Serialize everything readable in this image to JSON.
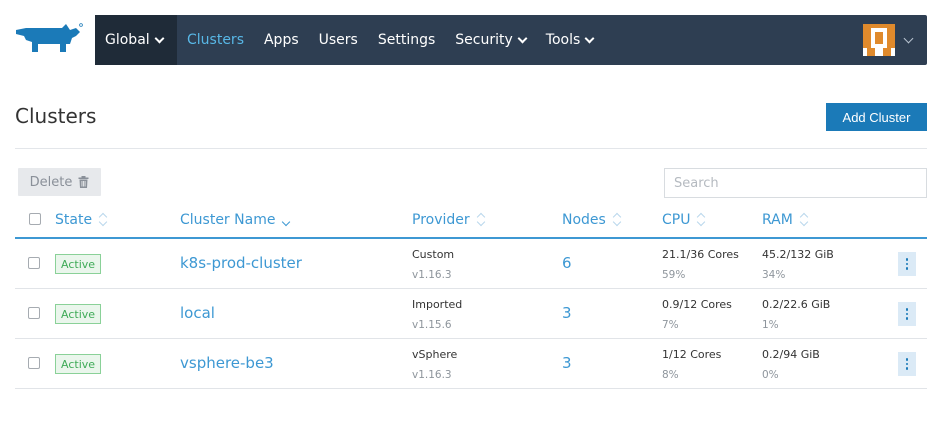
{
  "nav": {
    "global_label": "Global",
    "items": [
      {
        "label": "Clusters",
        "active": true
      },
      {
        "label": "Apps"
      },
      {
        "label": "Users"
      },
      {
        "label": "Settings"
      },
      {
        "label": "Security",
        "dropdown": true
      },
      {
        "label": "Tools",
        "dropdown": true
      }
    ]
  },
  "page": {
    "title": "Clusters",
    "add_button": "Add Cluster",
    "delete_button": "Delete",
    "search_placeholder": "Search"
  },
  "table": {
    "headers": {
      "state": "State",
      "name": "Cluster Name",
      "provider": "Provider",
      "nodes": "Nodes",
      "cpu": "CPU",
      "ram": "RAM"
    },
    "rows": [
      {
        "state": "Active",
        "name": "k8s-prod-cluster",
        "provider": "Custom",
        "version": "v1.16.3",
        "nodes": "6",
        "cpu": "21.1/36 Cores",
        "cpu_pct": "59%",
        "ram": "45.2/132 GiB",
        "ram_pct": "34%"
      },
      {
        "state": "Active",
        "name": "local",
        "provider": "Imported",
        "version": "v1.15.6",
        "nodes": "3",
        "cpu": "0.9/12 Cores",
        "cpu_pct": "7%",
        "ram": "0.2/22.6 GiB",
        "ram_pct": "1%"
      },
      {
        "state": "Active",
        "name": "vsphere-be3",
        "provider": "vSphere",
        "version": "v1.16.3",
        "nodes": "3",
        "cpu": "1/12 Cores",
        "cpu_pct": "8%",
        "ram": "0.2/94 GiB",
        "ram_pct": "0%"
      }
    ]
  },
  "colors": {
    "nav_bg": "#2e3e52",
    "accent": "#3d98d3",
    "primary_button": "#1b7ab8",
    "active_badge": "#3eaa57"
  },
  "icons": [
    "rancher-logo-icon",
    "chevron-down-icon",
    "user-avatar-icon",
    "trash-icon",
    "sort-icon",
    "kebab-menu-icon"
  ]
}
